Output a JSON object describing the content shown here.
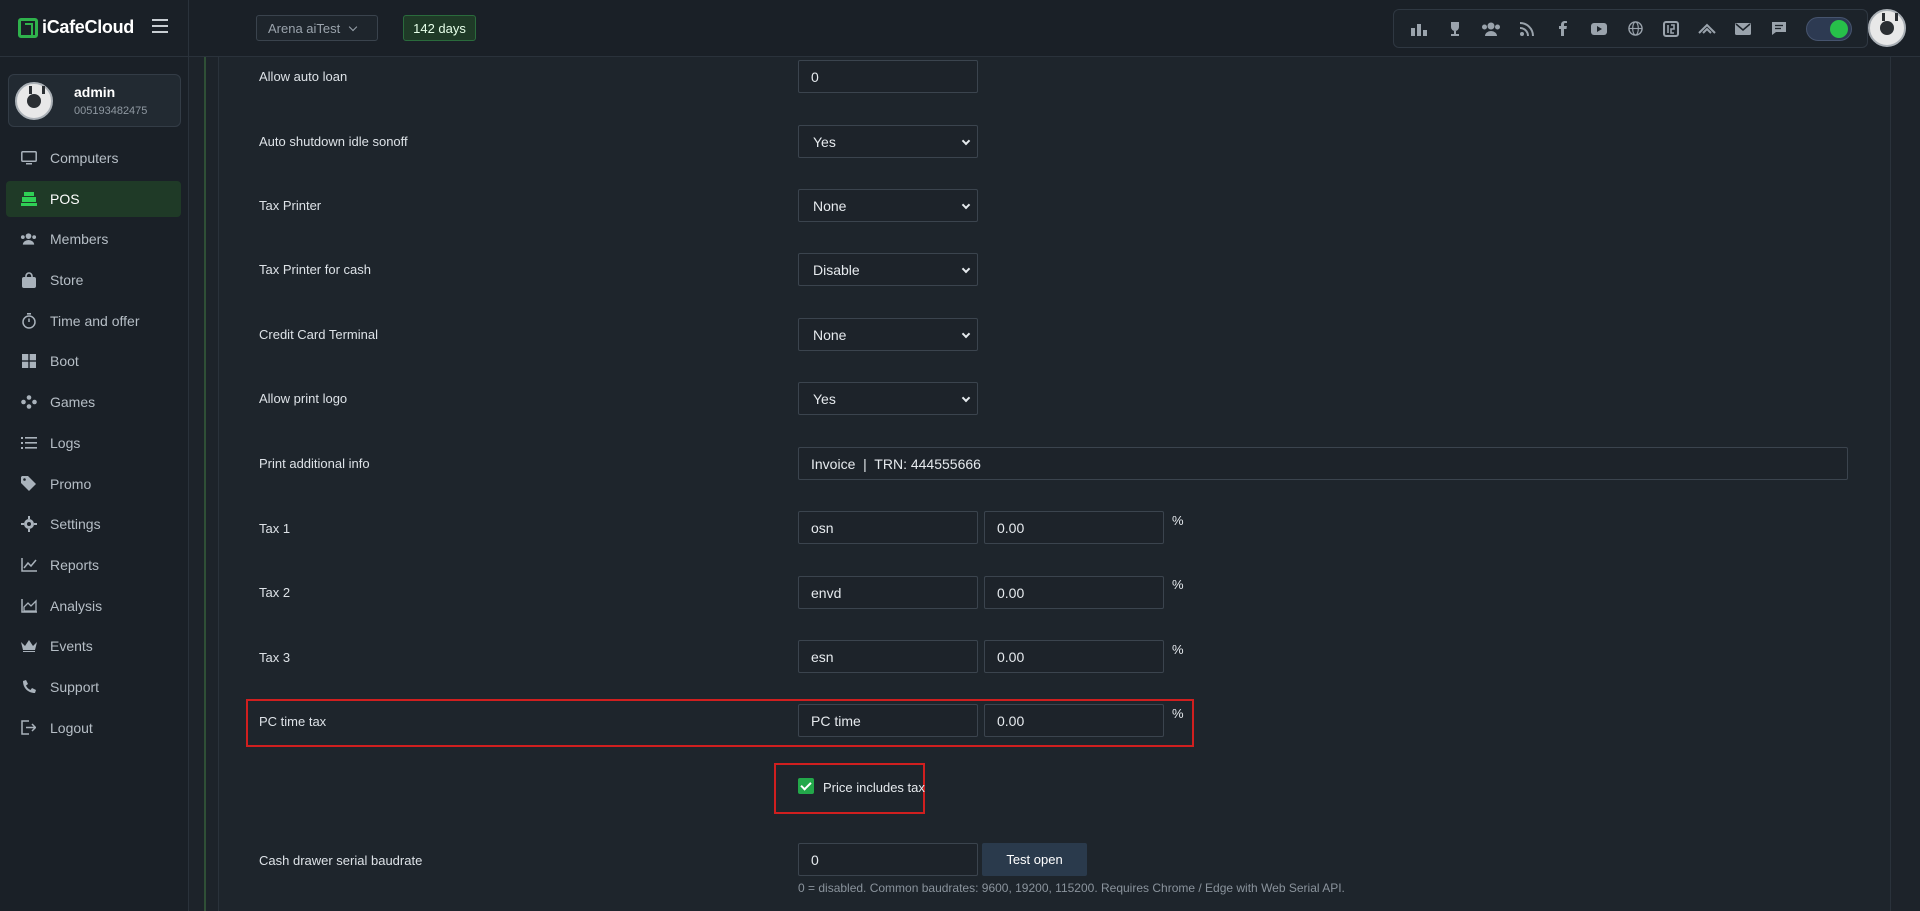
{
  "app": {
    "logo_text": "iCafeCloud"
  },
  "header": {
    "arena_select": "Arena aiTest",
    "days_badge": "142 days",
    "tray_icons": [
      "ranking-icon",
      "trophy-icon",
      "group-icon",
      "rss-icon",
      "facebook-icon",
      "youtube-icon",
      "globe-icon",
      "icafe-icon",
      "double-chevron-icon",
      "mail-icon",
      "chat-icon"
    ]
  },
  "user": {
    "name": "admin",
    "id": "005193482475"
  },
  "sidebar": {
    "items": [
      {
        "label": "Computers",
        "icon": "monitor-icon",
        "active": false
      },
      {
        "label": "POS",
        "icon": "cash-register-icon",
        "active": true
      },
      {
        "label": "Members",
        "icon": "users-icon",
        "active": false
      },
      {
        "label": "Store",
        "icon": "bag-icon",
        "active": false
      },
      {
        "label": "Time and offer",
        "icon": "stopwatch-icon",
        "active": false
      },
      {
        "label": "Boot",
        "icon": "windows-icon",
        "active": false
      },
      {
        "label": "Games",
        "icon": "gamepad-icon",
        "active": false
      },
      {
        "label": "Logs",
        "icon": "list-icon",
        "active": false
      },
      {
        "label": "Promo",
        "icon": "tag-icon",
        "active": false
      },
      {
        "label": "Settings",
        "icon": "gear-icon",
        "active": false
      },
      {
        "label": "Reports",
        "icon": "line-chart-icon",
        "active": false
      },
      {
        "label": "Analysis",
        "icon": "area-chart-icon",
        "active": false
      },
      {
        "label": "Events",
        "icon": "crown-icon",
        "active": false
      },
      {
        "label": "Support",
        "icon": "phone-icon",
        "active": false
      },
      {
        "label": "Logout",
        "icon": "logout-icon",
        "active": false
      }
    ]
  },
  "form": {
    "allow_auto_loan": {
      "label": "Allow auto loan",
      "value": "0"
    },
    "auto_shutdown": {
      "label": "Auto shutdown idle sonoff",
      "value": "Yes"
    },
    "tax_printer": {
      "label": "Tax Printer",
      "value": "None"
    },
    "tax_printer_cash": {
      "label": "Tax Printer for cash",
      "value": "Disable"
    },
    "credit_card_terminal": {
      "label": "Credit Card Terminal",
      "value": "None"
    },
    "allow_print_logo": {
      "label": "Allow print logo",
      "value": "Yes"
    },
    "print_additional_info": {
      "label": "Print additional info",
      "value": "Invoice  |  TRN: 444555666"
    },
    "tax1": {
      "label": "Tax 1",
      "name": "osn",
      "rate": "0.00",
      "unit": "%"
    },
    "tax2": {
      "label": "Tax 2",
      "name": "envd",
      "rate": "0.00",
      "unit": "%"
    },
    "tax3": {
      "label": "Tax 3",
      "name": "esn",
      "rate": "0.00",
      "unit": "%"
    },
    "pc_time_tax": {
      "label": "PC time tax",
      "name": "PC time",
      "rate": "0.00",
      "unit": "%"
    },
    "price_includes_tax": {
      "label": "Price includes tax",
      "checked": true
    },
    "cash_drawer": {
      "label": "Cash drawer serial baudrate",
      "value": "0",
      "button": "Test open",
      "hint": "0 = disabled. Common baudrates: 9600, 19200, 115200. Requires Chrome / Edge with Web Serial API."
    }
  },
  "colors": {
    "accent": "#2fb24c",
    "highlight": "#d01f1f",
    "background": "#1e252c"
  }
}
